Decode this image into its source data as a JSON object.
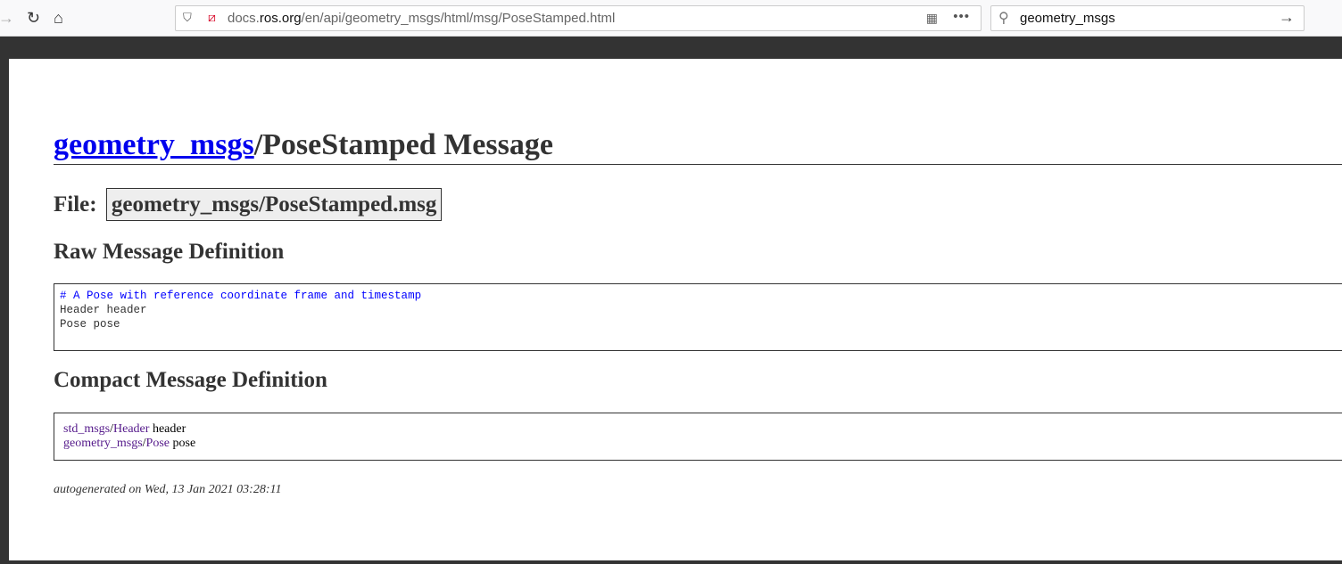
{
  "browser": {
    "url_host_pre": "docs.",
    "url_host": "ros.org",
    "url_path": "/en/api/geometry_msgs/html/msg/PoseStamped.html",
    "search_value": "geometry_msgs"
  },
  "page": {
    "title_link": "geometry_msgs",
    "title_rest": "/PoseStamped Message",
    "file_label": "File:",
    "file_name": "geometry_msgs/PoseStamped.msg",
    "raw_heading": "Raw Message Definition",
    "raw_lines": [
      "# A Pose with reference coordinate frame and timestamp",
      "Header header",
      "Pose pose"
    ],
    "compact_heading": "Compact Message Definition",
    "compact": [
      {
        "pkg": "std_msgs",
        "type": "Header",
        "name": " header"
      },
      {
        "pkg": "geometry_msgs",
        "type": "Pose",
        "name": " pose"
      }
    ],
    "footer": "autogenerated on Wed, 13 Jan 2021 03:28:11"
  }
}
